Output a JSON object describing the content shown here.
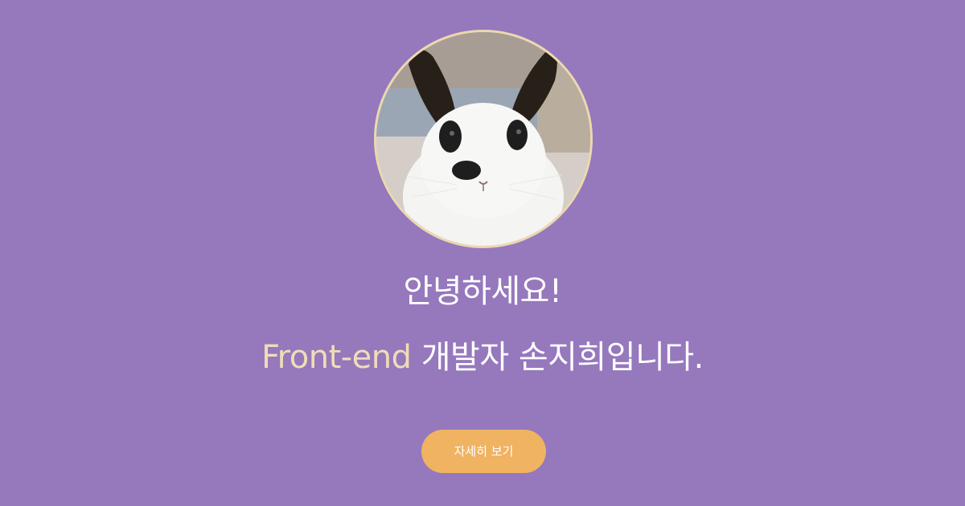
{
  "hero": {
    "avatar": {
      "subject": "rabbit-photo"
    },
    "greeting_line1": "안녕하세요!",
    "greeting_accent": "Front-end",
    "greeting_line2_rest": " 개발자 손지희입니다.",
    "cta_label": "자세히 보기"
  },
  "colors": {
    "background": "#9678bd",
    "accent_text": "#f0dcb6",
    "button": "#f0b362",
    "avatar_border": "#ecd8b0"
  }
}
